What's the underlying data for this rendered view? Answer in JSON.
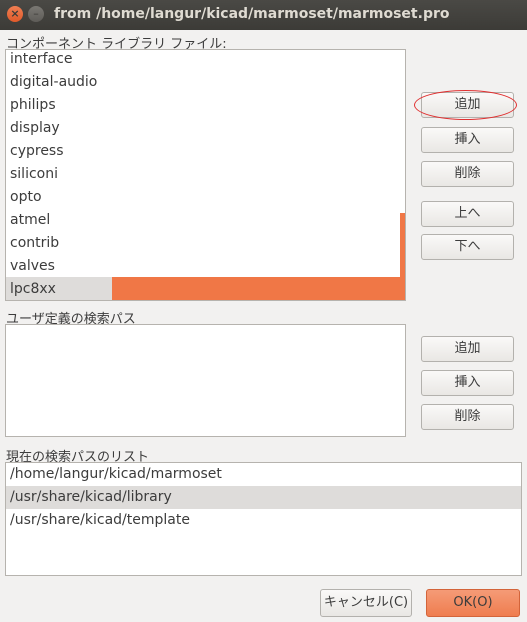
{
  "window": {
    "title": "from /home/langur/kicad/marmoset/marmoset.pro",
    "close_glyph": "×",
    "minimize_glyph": "–"
  },
  "component_libraries": {
    "label": "コンポーネント ライブラリ ファイル:",
    "items": [
      "interface",
      "digital-audio",
      "philips",
      "display",
      "cypress",
      "siliconi",
      "opto",
      "atmel",
      "contrib",
      "valves",
      "lpc8xx"
    ],
    "selected": "lpc8xx",
    "buttons": {
      "add": "追加",
      "insert": "挿入",
      "delete": "削除",
      "up": "上へ",
      "down": "下へ"
    }
  },
  "user_paths": {
    "label": "ユーザ定義の検索パス",
    "buttons": {
      "add": "追加",
      "insert": "挿入",
      "delete": "削除"
    }
  },
  "current_paths": {
    "label": "現在の検索パスのリスト",
    "items": [
      "/home/langur/kicad/marmoset",
      "/usr/share/kicad/library",
      "/usr/share/kicad/template"
    ],
    "selected": "/usr/share/kicad/library"
  },
  "footer": {
    "cancel": "キャンセル(C)",
    "ok": "OK(O)"
  },
  "colors": {
    "accent": "#f07746",
    "annotation_circle": "#e03030",
    "titlebar": "#3c3b37"
  }
}
